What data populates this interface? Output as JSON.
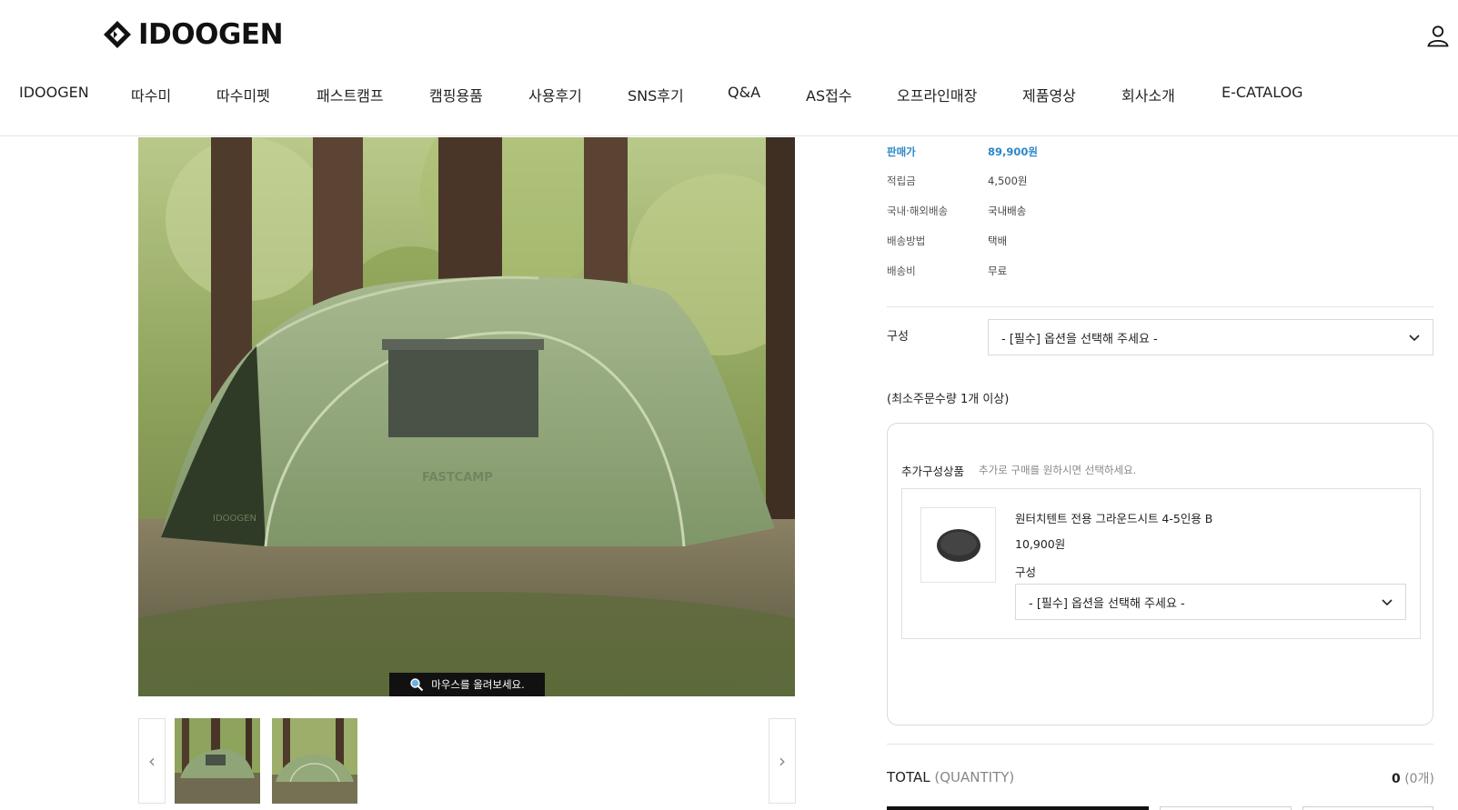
{
  "header": {
    "logo_text": "IDOOGEN",
    "nav": [
      "IDOOGEN",
      "따수미",
      "따수미펫",
      "패스트캠프",
      "캠핑용품",
      "사용후기",
      "SNS후기",
      "Q&A",
      "AS접수",
      "오프라인매장",
      "제품영상",
      "회사소개",
      "E-CATALOG"
    ]
  },
  "gallery": {
    "zoom_tip": "마우스를 올려보세요.",
    "tent_print_brand": "FASTCAMP",
    "tent_print_logo": "IDOOGEN"
  },
  "product": {
    "price_label": "판매가",
    "price_value": "89,900원",
    "points_label": "적립금",
    "points_value": "4,500원",
    "shipping_scope_label": "국내·해외배송",
    "shipping_scope_value": "국내배송",
    "shipping_method_label": "배송방법",
    "shipping_method_value": "택배",
    "shipping_fee_label": "배송비",
    "shipping_fee_value": "무료",
    "option_label": "구성",
    "option_select": "- [필수] 옵션을 선택해 주세요 -",
    "min_qty_note": "(최소주문수량 1개 이상)"
  },
  "addon": {
    "title": "추가구성상품",
    "desc": "추가로 구매를 원하시면 선택하세요.",
    "item": {
      "name": "원터치텐트 전용 그라운드시트 4-5인용 B",
      "price": "10,900원",
      "option_label": "구성",
      "option_select": "- [필수] 옵션을 선택해 주세요 -"
    }
  },
  "total": {
    "label": "TOTAL",
    "quantity_label": "(QUANTITY)",
    "amount": "0",
    "count": "(0개)"
  },
  "colors": {
    "price_blue": "#2b88c8",
    "text_dark": "#222222",
    "border": "#dadada"
  }
}
